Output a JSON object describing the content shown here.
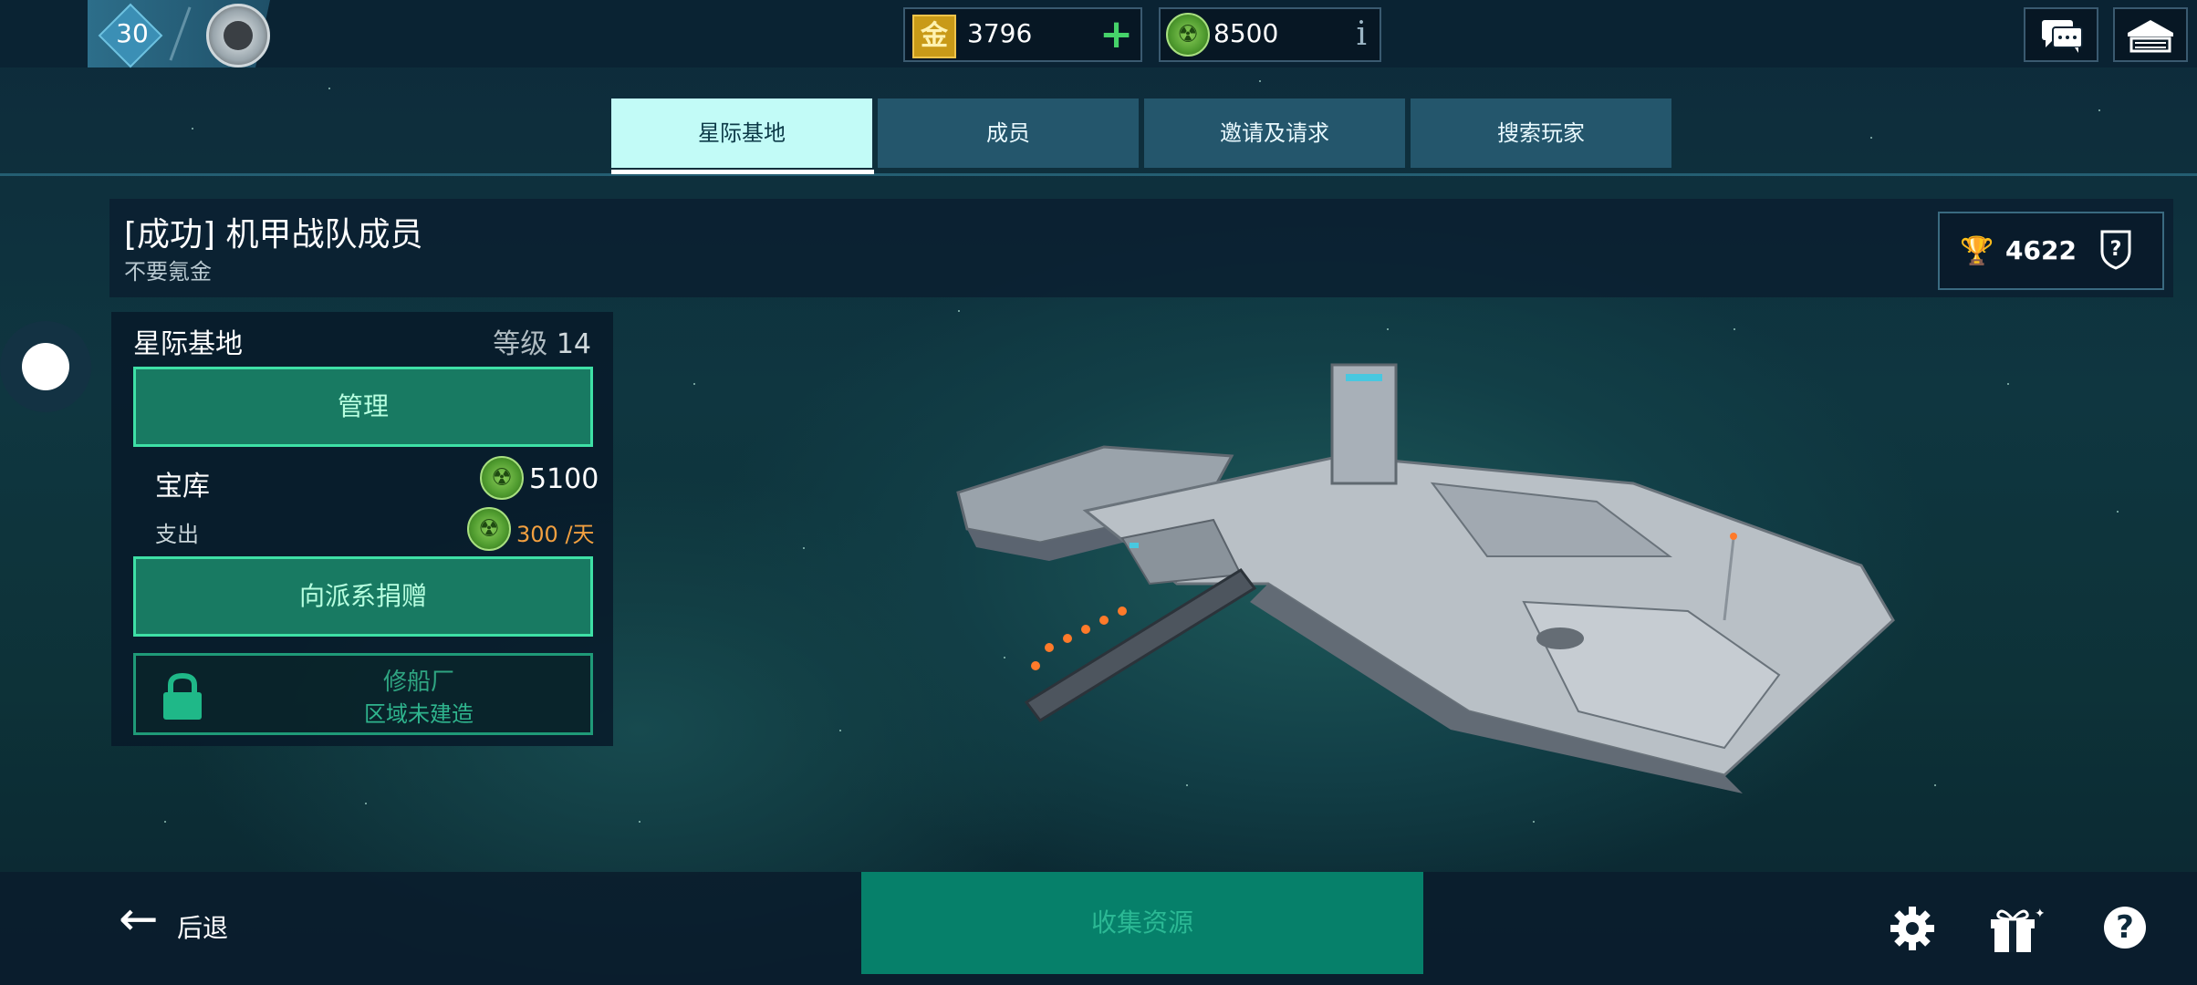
{
  "topbar": {
    "level": "30",
    "gold": "3796",
    "credits": "8500",
    "gold_icon": "金"
  },
  "tabs": [
    {
      "label": "星际基地",
      "active": true
    },
    {
      "label": "成员",
      "active": false
    },
    {
      "label": "邀请及请求",
      "active": false
    },
    {
      "label": "搜索玩家",
      "active": false
    }
  ],
  "group": {
    "title": "[成功] 机甲战队成员",
    "subtitle": "不要氪金",
    "trophies": "4622"
  },
  "panel": {
    "title": "星际基地",
    "level_label": "等级",
    "level_value": "14",
    "manage_label": "管理",
    "vault_label": "宝库",
    "vault_value": "5100",
    "cost_label": "支出",
    "cost_value": "300 /天",
    "donate_label": "向派系捐赠",
    "locked_title": "修船厂",
    "locked_sub": "区域未建造"
  },
  "bottom": {
    "back_label": "后退",
    "collect_label": "收集资源"
  },
  "colors": {
    "accent_green": "#3ee0a6",
    "tab_active": "#c2fbf7",
    "cost_orange": "#f2a040"
  }
}
